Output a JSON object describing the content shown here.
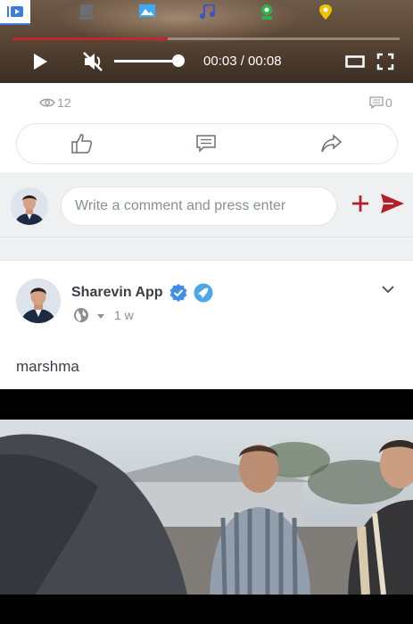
{
  "tabs": [
    {
      "name": "videos-tab-icon",
      "color": "#3f7ae0",
      "active": true
    },
    {
      "name": "documents-tab-icon",
      "color": "#6b6f75",
      "active": false
    },
    {
      "name": "images-tab-icon",
      "color": "#3fa9f5",
      "active": false
    },
    {
      "name": "music-tab-icon",
      "color": "#3f50c8",
      "active": false
    },
    {
      "name": "webcam-tab-icon",
      "color": "#2db34a",
      "active": false
    },
    {
      "name": "location-tab-icon",
      "color": "#f2c200",
      "active": false
    }
  ],
  "player": {
    "current_time": "00:03",
    "duration": "00:08",
    "time_display": "00:03 / 00:08",
    "progress_fraction": 0.4,
    "volume_fraction": 1.0,
    "muted": true
  },
  "post1": {
    "views": "12",
    "comments": "0"
  },
  "comment": {
    "placeholder": "Write a comment and press enter"
  },
  "post2": {
    "author": "Sharevin App",
    "privacy_icon": "globe-icon",
    "time_ago": "1 w",
    "text": "marshma"
  },
  "colors": {
    "accent_red": "#b3202a",
    "progress_red": "#c1272d",
    "verified_blue": "#3f8fe6",
    "muted_text": "#8a8f95"
  }
}
